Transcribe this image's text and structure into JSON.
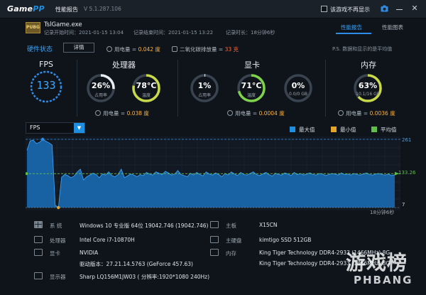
{
  "titlebar": {
    "app_name_a": "Game",
    "app_name_b": "PP",
    "title": "性能报告",
    "version": "V 5.1.287.106",
    "checkbox_label": "该游戏不再显示"
  },
  "game": {
    "icon_text": "PUBG",
    "name": "TslGame.exe",
    "start_time": "记录开始时间：2021-01-15 13:04",
    "end_time": "记录结束时间：2021-01-15 13:22",
    "duration": "记录时长：18分钟6秒"
  },
  "tabs": {
    "perf": "性能报告",
    "chart": "性能图表"
  },
  "summary": {
    "hw_status_label": "硬件状态",
    "detail_button": "详情",
    "power_label": "用电量 =",
    "power_value": "0.042 度",
    "co2_label": "二氧化碳排放量 =",
    "co2_value": "33 克",
    "ps_note": "P.S. 数据和显示的是平均值"
  },
  "fps": {
    "title": "FPS",
    "value": "133"
  },
  "cpu": {
    "title": "处理器",
    "usage": {
      "value": "26%",
      "label": "占用率",
      "fraction": 0.26,
      "color": "#e9edf1"
    },
    "temp": {
      "value": "78°C",
      "label": "温度",
      "fraction": 0.78,
      "color": "#c8d94a"
    },
    "power_label": "用电量 =",
    "power_value": "0.038 度"
  },
  "gpu": {
    "title": "显卡",
    "usage": {
      "value": "1%",
      "label": "占用率",
      "fraction": 0.01,
      "color": "#e9edf1"
    },
    "temp": {
      "value": "71°C",
      "label": "温度",
      "fraction": 0.71,
      "color": "#7fd34a"
    },
    "vram": {
      "value": "0%",
      "label": "0.0/0 GB",
      "fraction": 0.0,
      "color": "#e9edf1"
    },
    "power_label": "用电量 =",
    "power_value": "0.0004 度"
  },
  "memory": {
    "title": "内存",
    "usage": {
      "value": "63%",
      "label": "10.1/16 GB",
      "fraction": 0.63,
      "color": "#c8d94a"
    },
    "power_label": "用电量 =",
    "power_value": "0.0036 度"
  },
  "chart": {
    "selector": "FPS",
    "legend": [
      {
        "label": "最大值",
        "color": "#1e8fe0"
      },
      {
        "label": "最小值",
        "color": "#e6a52a"
      },
      {
        "label": "平均值",
        "color": "#5fbf4a"
      }
    ]
  },
  "chart_data": {
    "type": "area",
    "title": "",
    "xlabel": "",
    "ylabel": "",
    "ylim": [
      7,
      261
    ],
    "max_value": "261",
    "avg_value": "133.26",
    "min_value": "7",
    "x_end_label": "18分钟6秒",
    "series": [
      {
        "values": [
          220,
          255,
          258,
          245,
          250,
          261,
          254,
          248,
          240,
          15,
          7,
          120,
          130,
          126,
          118,
          124,
          140,
          150,
          110,
          122,
          128,
          135,
          130,
          118,
          132,
          128,
          140,
          126,
          122,
          130,
          150,
          118,
          125,
          132,
          128,
          122,
          130,
          126,
          138,
          132,
          128,
          140,
          135,
          130,
          142,
          136,
          128,
          132,
          145,
          130,
          126,
          122,
          135,
          128,
          138,
          130,
          125,
          140,
          132,
          128,
          136,
          130,
          122,
          134,
          128,
          140,
          132,
          126,
          138,
          130,
          128,
          134,
          140,
          130,
          126,
          132,
          138,
          130,
          124,
          135,
          130,
          128,
          136,
          132,
          126,
          138,
          130,
          134,
          128,
          132,
          136,
          130,
          128,
          134,
          132,
          126,
          130,
          134,
          132,
          128,
          136,
          130,
          132,
          128,
          134,
          130,
          128,
          132,
          136,
          130,
          128,
          132,
          134,
          130,
          128,
          132,
          126,
          130
        ]
      }
    ]
  },
  "sysinfo": {
    "os_key": "系 统",
    "os_val": "Windows 10 专业版 64位  19042.746 (19042.746)",
    "cpu_key": "处理器",
    "cpu_val": "Intel Core i7-10870H",
    "gpu_key": "显卡",
    "gpu_val": "NVIDIA",
    "driver_val": "驱动版本：27.21.14.5763 (GeForce 457.63)",
    "monitor_key": "显示器",
    "monitor_val": "Sharp LQ156M1JW03 ( 分辨率:1920*1080 240Hz)",
    "mb_key": "主板",
    "mb_val": "X15CN",
    "disk_key": "主硬盘",
    "disk_val": "kimtigo SSD 512GB",
    "mem_key": "内存",
    "mem_val1": "King Tiger Technology DDR4-2933 (1466MHz) 8G",
    "mem_val2": "King Tiger Technology DDR4-2933 (1466MHz) 8G"
  },
  "watermark": {
    "big": "游戏榜",
    "small": "PHBANG"
  }
}
